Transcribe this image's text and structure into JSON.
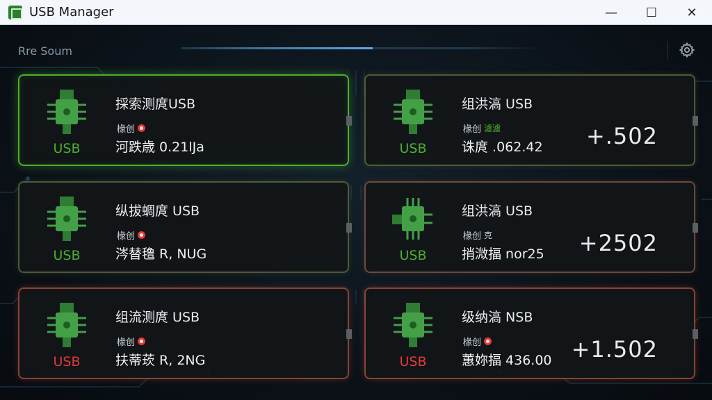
{
  "window": {
    "title": "USB Manager",
    "controls": {
      "minimize": "—",
      "maximize": "☐",
      "close": "✕"
    }
  },
  "header": {
    "label": "Rre Soum",
    "progress": 0.53,
    "settings_icon": "gear-icon"
  },
  "colors": {
    "accent_green": "#4caf2e",
    "accent_red": "#e53935",
    "progress_blue": "#5aa9e6"
  },
  "devices": [
    {
      "title": "採索测庹USB",
      "status_label": "椽创",
      "status_indicator": "red-dot",
      "status_tag": "",
      "detail": "河跌歳 0.21lJa",
      "value": "",
      "usb_label": "USB",
      "usb_color": "green",
      "frame": "green"
    },
    {
      "title": "组洪滈 USB",
      "status_label": "椽创",
      "status_indicator": "",
      "status_tag": "濾濾",
      "detail": "诛庹 .062.42",
      "value": "+.502",
      "usb_label": "USB",
      "usb_color": "green",
      "frame": "olive"
    },
    {
      "title": "纵拔蜩庹 USB",
      "status_label": "椽创",
      "status_indicator": "red-dot",
      "status_tag": "",
      "detail": "涔替氇 R, NUG",
      "value": "",
      "usb_label": "USB",
      "usb_color": "green",
      "frame": "olive"
    },
    {
      "title": "组洪滈 USB",
      "status_label": "椽创",
      "status_indicator": "",
      "status_tag": "克",
      "detail": "捎溦揊 nor25",
      "value": "+2502",
      "usb_label": "USB",
      "usb_color": "green",
      "frame": "brown"
    },
    {
      "title": "组流测庹 USB",
      "status_label": "椽创",
      "status_indicator": "red-dot",
      "status_tag": "",
      "detail": "扶蒂莰 R, 2NG",
      "value": "",
      "usb_label": "USB",
      "usb_color": "red",
      "frame": "red"
    },
    {
      "title": "级纳滈 NSB",
      "status_label": "椽创",
      "status_indicator": "red-dot",
      "status_tag": "",
      "detail": "蕙妳揊 436.00",
      "value": "+1.502",
      "usb_label": "USB",
      "usb_color": "red",
      "frame": "red"
    }
  ]
}
